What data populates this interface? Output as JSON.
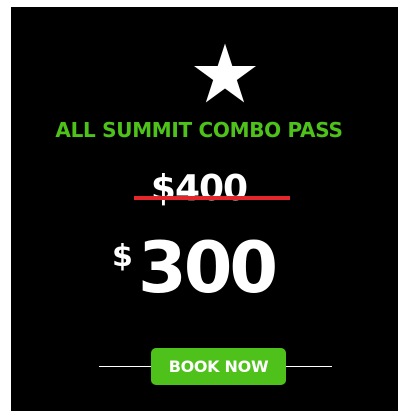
{
  "icon": {
    "name": "star-icon",
    "color": "#ffffff"
  },
  "title": "ALL SUMMIT COMBO PASS",
  "price": {
    "old": "$400",
    "currency": "$",
    "new": "300"
  },
  "cta": {
    "label": "BOOK NOW"
  },
  "colors": {
    "background": "#000000",
    "accent_green": "#4ec11a",
    "strike_red": "#e5262a",
    "text": "#ffffff"
  }
}
